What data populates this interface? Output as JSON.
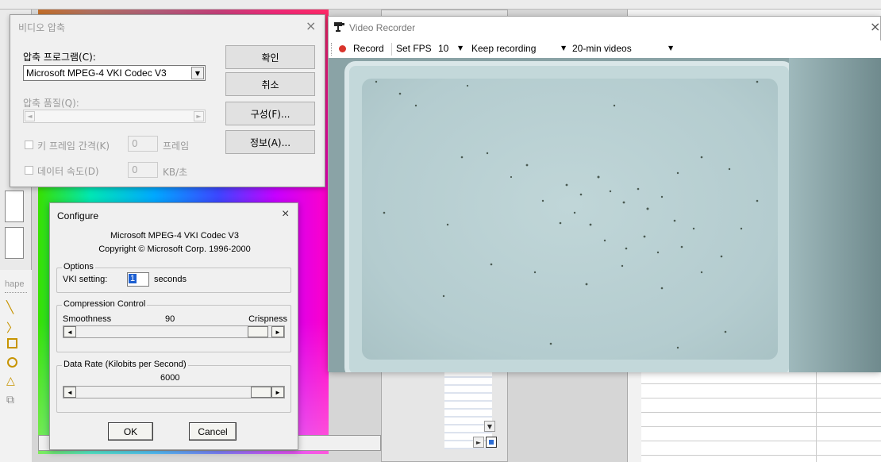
{
  "compress": {
    "title": "비디오 압축",
    "program_label": "압축 프로그램(C):",
    "program_value": "Microsoft MPEG-4  VKI  Codec V3",
    "quality_label": "압축 품질(Q):",
    "keyframe_label": "키 프레임 간격(K)",
    "keyframe_value": "0",
    "keyframe_unit": "프레임",
    "datarate_label": "데이터 속도(D)",
    "datarate_value": "0",
    "datarate_unit": "KB/초",
    "ok": "확인",
    "cancel": "취소",
    "configure": "구성(F)...",
    "about": "정보(A)...",
    "close": "×"
  },
  "configure": {
    "title": "Configure",
    "codec": "Microsoft MPEG-4  VKI  Codec V3",
    "copyright": "Copyright © Microsoft Corp. 1996-2000",
    "options_label": "Options",
    "vki_label": "VKI setting:",
    "vki_value": "1",
    "vki_unit": "seconds",
    "compression_label": "Compression Control",
    "smoothness": "Smoothness",
    "compression_value": "90",
    "crispness": "Crispness",
    "datarate_group": "Data Rate (Kilobits per Second)",
    "datarate_value": "6000",
    "ok": "OK",
    "cancel": "Cancel",
    "close": "×"
  },
  "recorder": {
    "title": "Video Recorder",
    "record": "Record",
    "set_fps": "Set FPS",
    "fps_value": "10",
    "mode": "Keep recording",
    "split": "20-min videos",
    "close": "×"
  },
  "background": {
    "shape_label": "hape"
  },
  "colors": {
    "record_dot": "#d9342b",
    "preview_bg": "#b9cfd2"
  }
}
